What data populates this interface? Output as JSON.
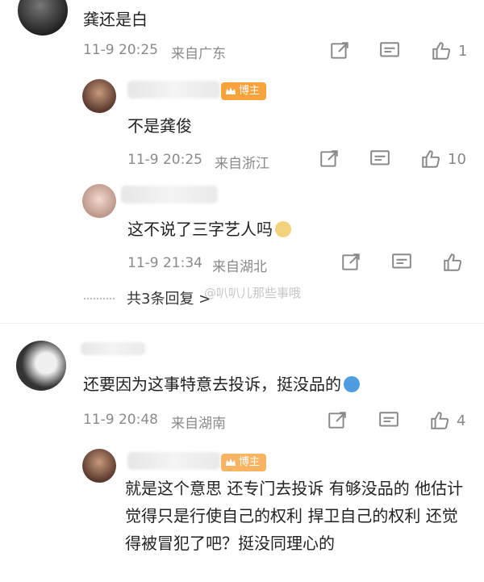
{
  "comments": [
    {
      "text": "龚还是白",
      "time": "11-9 20:25",
      "location": "来自广东",
      "likes": "1"
    },
    {
      "badge": "博主",
      "text": "不是龚俊",
      "time": "11-9 20:25",
      "location": "来自浙江",
      "likes": "10"
    },
    {
      "text": "这不说了三字艺人吗",
      "time": "11-9 21:34",
      "location": "来自湖北",
      "likes": ""
    },
    {
      "text": "还要因为这事特意去投诉，挺没品的",
      "time": "11-9 20:48",
      "location": "来自湖南",
      "likes": "4"
    },
    {
      "badge": "博主",
      "text": "就是这个意思 还专门去投诉 有够没品的 他估计觉得只是行使自己的权利 捍卫自己的权利 还觉得被冒犯了吧？挺没同理心的"
    }
  ],
  "replies_link": "共3条回复 >",
  "watermark": "@叭叭儿那些事哦",
  "icons": [
    "share-icon",
    "comment-icon",
    "like-icon",
    "crown-icon"
  ]
}
